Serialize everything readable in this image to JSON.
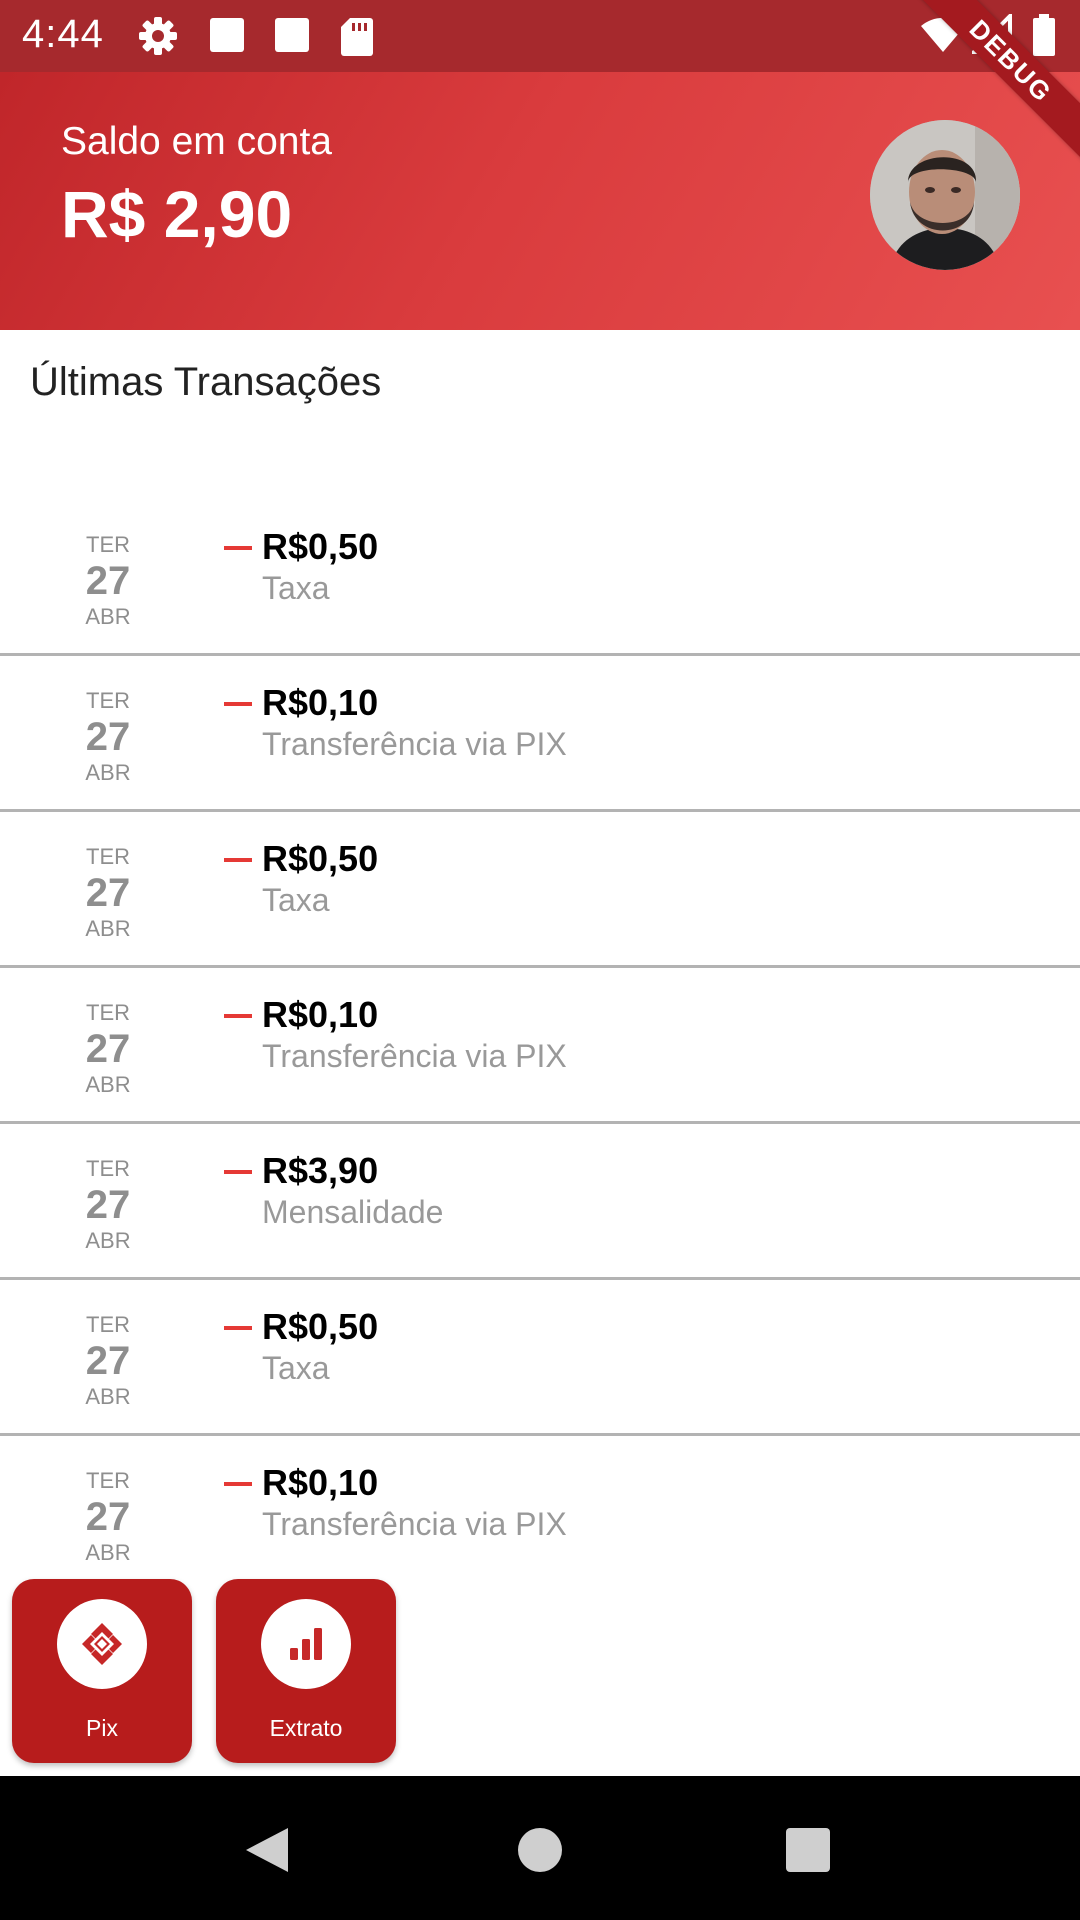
{
  "status_bar": {
    "time": "4:44",
    "left_icons": [
      "gear-icon",
      "notification-square-icon",
      "notification-square-icon",
      "sd-card-icon"
    ],
    "right_icons": [
      "wifi-icon",
      "signal-icon",
      "battery-icon"
    ],
    "debug_label": "DEBUG"
  },
  "header": {
    "balance_label": "Saldo em conta",
    "balance_value": "R$ 2,90",
    "gradient_colors": [
      "#c0262a",
      "#e85050"
    ]
  },
  "transactions": {
    "title": "Últimas Transações",
    "items": [
      {
        "weekday": "TER",
        "day": "27",
        "month": "ABR",
        "sign": "—",
        "amount": "R$0,50",
        "description": "Taxa"
      },
      {
        "weekday": "TER",
        "day": "27",
        "month": "ABR",
        "sign": "—",
        "amount": "R$0,10",
        "description": "Transferência via PIX"
      },
      {
        "weekday": "TER",
        "day": "27",
        "month": "ABR",
        "sign": "—",
        "amount": "R$0,50",
        "description": "Taxa"
      },
      {
        "weekday": "TER",
        "day": "27",
        "month": "ABR",
        "sign": "—",
        "amount": "R$0,10",
        "description": "Transferência via PIX"
      },
      {
        "weekday": "TER",
        "day": "27",
        "month": "ABR",
        "sign": "—",
        "amount": "R$3,90",
        "description": "Mensalidade"
      },
      {
        "weekday": "TER",
        "day": "27",
        "month": "ABR",
        "sign": "—",
        "amount": "R$0,50",
        "description": "Taxa"
      },
      {
        "weekday": "TER",
        "day": "27",
        "month": "ABR",
        "sign": "—",
        "amount": "R$0,10",
        "description": "Transferência via PIX"
      }
    ]
  },
  "actions": [
    {
      "label": "Pix",
      "icon": "pix-icon"
    },
    {
      "label": "Extrato",
      "icon": "bar-chart-icon"
    }
  ],
  "nav_bar": {
    "buttons": [
      "back-icon",
      "home-icon",
      "recents-icon"
    ]
  },
  "colors": {
    "accent": "#b71c1c",
    "negative_sign": "#e53935",
    "muted_text": "#999999"
  }
}
